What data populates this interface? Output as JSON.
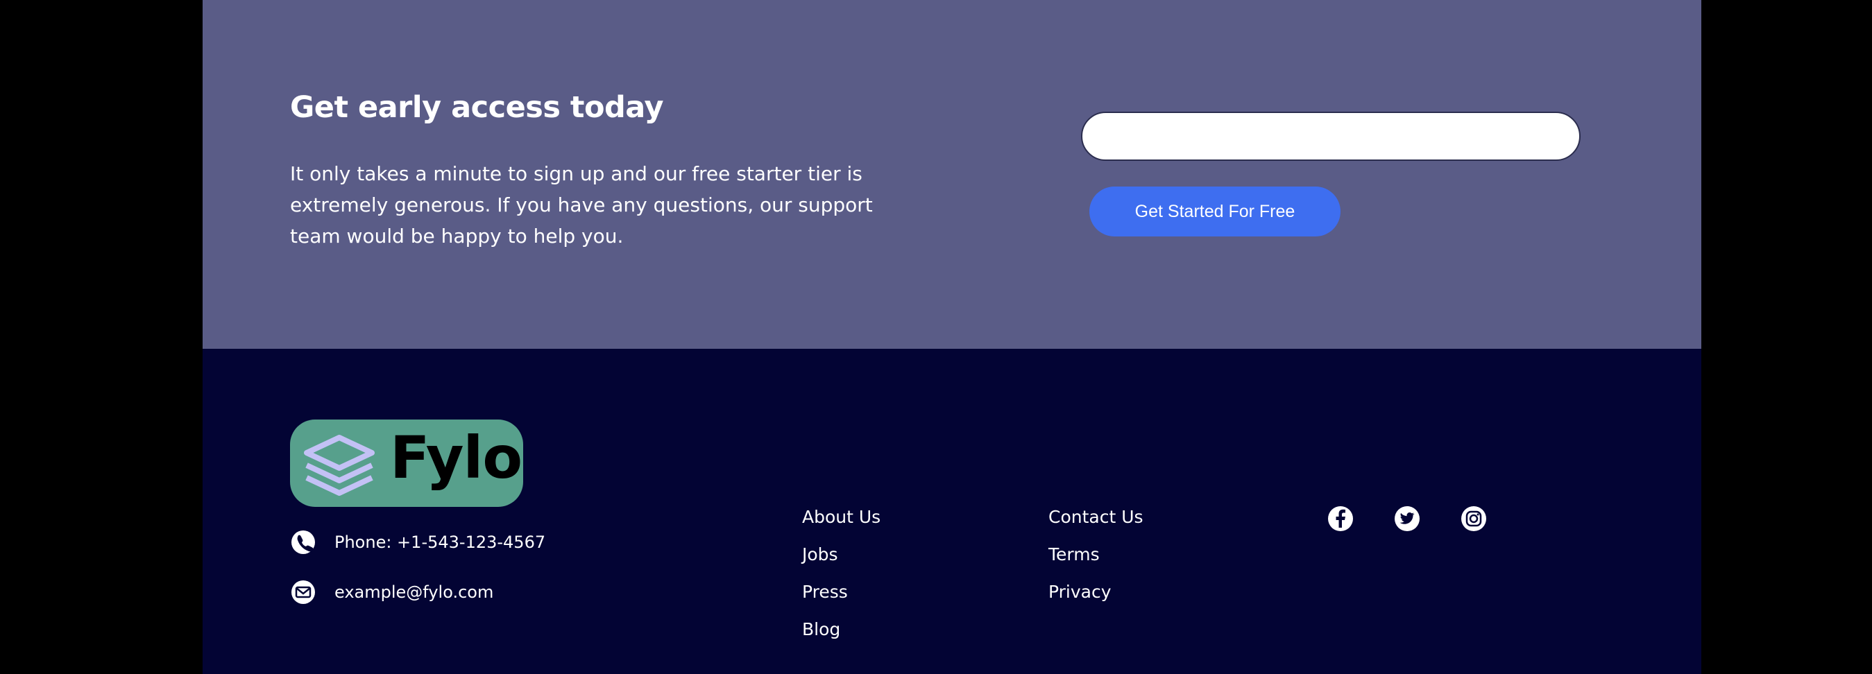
{
  "cta": {
    "title": "Get early access today",
    "description": "It only takes a minute to sign up and our free starter tier is extremely generous. If you have any questions, our support team would be happy to help you.",
    "email_value": "",
    "button_label": "Get Started For Free"
  },
  "footer": {
    "logo_text": "Fylo",
    "phone": "Phone: +1-543-123-4567",
    "email": "example@fylo.com",
    "links_col1": [
      "About Us",
      "Jobs",
      "Press",
      "Blog"
    ],
    "links_col2": [
      "Contact Us",
      "Terms",
      "Privacy"
    ],
    "social_icons": [
      "facebook-icon",
      "twitter-icon",
      "instagram-icon"
    ]
  },
  "colors": {
    "cta_bg": "#5a5c87",
    "footer_bg": "#030434",
    "button_bg": "#3e6ef0",
    "logo_bg": "#57a08c",
    "logo_icon": "#c3c1f5"
  }
}
